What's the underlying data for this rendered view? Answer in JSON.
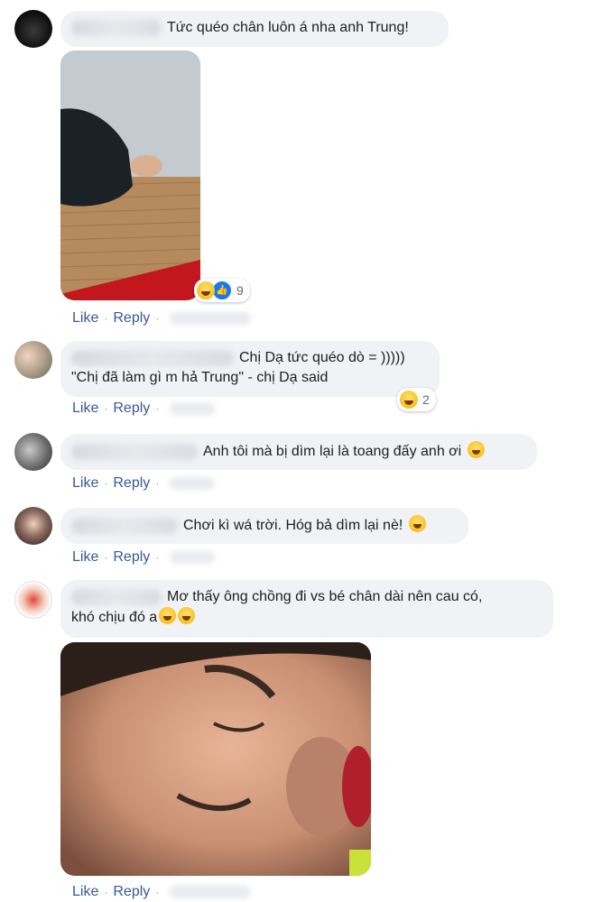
{
  "actions": {
    "like": "Like",
    "reply": "Reply",
    "separator": "·"
  },
  "comments": [
    {
      "text": "Tức quéo chân luôn á nha anh Trung!",
      "reaction_count": "9"
    },
    {
      "text_line1": "Chị Dạ tức quéo dò = )))))",
      "text_line2": "\"Chị đã làm gì m hả Trung\" - chị Dạ said",
      "reaction_count": "2"
    },
    {
      "text": "Anh tôi mà bị dìm lại là toang đấy anh ơi"
    },
    {
      "text": "Chơi kì wá trời. Hóg bả dìm lại nè!"
    },
    {
      "text_line1": "Mơ thấy ông chồng đi vs bé chân dài nên cau có,",
      "text_line2": "khó chịu đó a"
    }
  ],
  "icons": {
    "reaction_haha": "laughing-emoji",
    "reaction_like": "thumbs-up",
    "inline_rofl": "rolling-laughing-emoji",
    "inline_wink": "winking-tongue-emoji"
  },
  "colors": {
    "bubble": "#f0f2f5",
    "link": "#385898",
    "meta": "#65676b"
  }
}
